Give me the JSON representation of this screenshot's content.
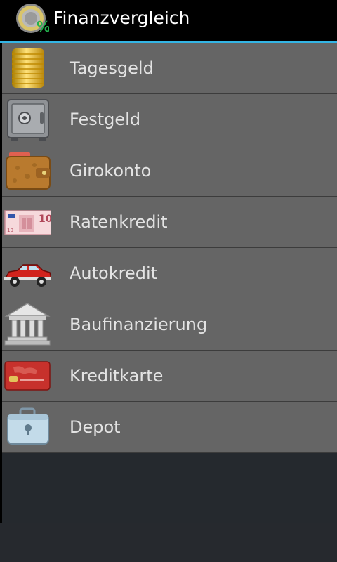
{
  "actionbar": {
    "title": "Finanzvergleich",
    "app_icon": "euro-coin-percent-icon"
  },
  "menu": {
    "items": [
      {
        "label": "Tagesgeld",
        "icon": "coin-stack-icon"
      },
      {
        "label": "Festgeld",
        "icon": "safe-icon"
      },
      {
        "label": "Girokonto",
        "icon": "wallet-icon"
      },
      {
        "label": "Ratenkredit",
        "icon": "euro-banknote-icon"
      },
      {
        "label": "Autokredit",
        "icon": "red-car-icon"
      },
      {
        "label": "Baufinanzierung",
        "icon": "bank-building-icon"
      },
      {
        "label": "Kreditkarte",
        "icon": "credit-card-icon"
      },
      {
        "label": "Depot",
        "icon": "briefcase-icon"
      }
    ]
  },
  "banknote_value": "10",
  "colors": {
    "actionbar": "#000000",
    "accent": "#33b5e5",
    "list_background": "#656565",
    "divider": "#3c3c3c",
    "label_text": "#e3e3e3",
    "page_background": "#25292e"
  }
}
